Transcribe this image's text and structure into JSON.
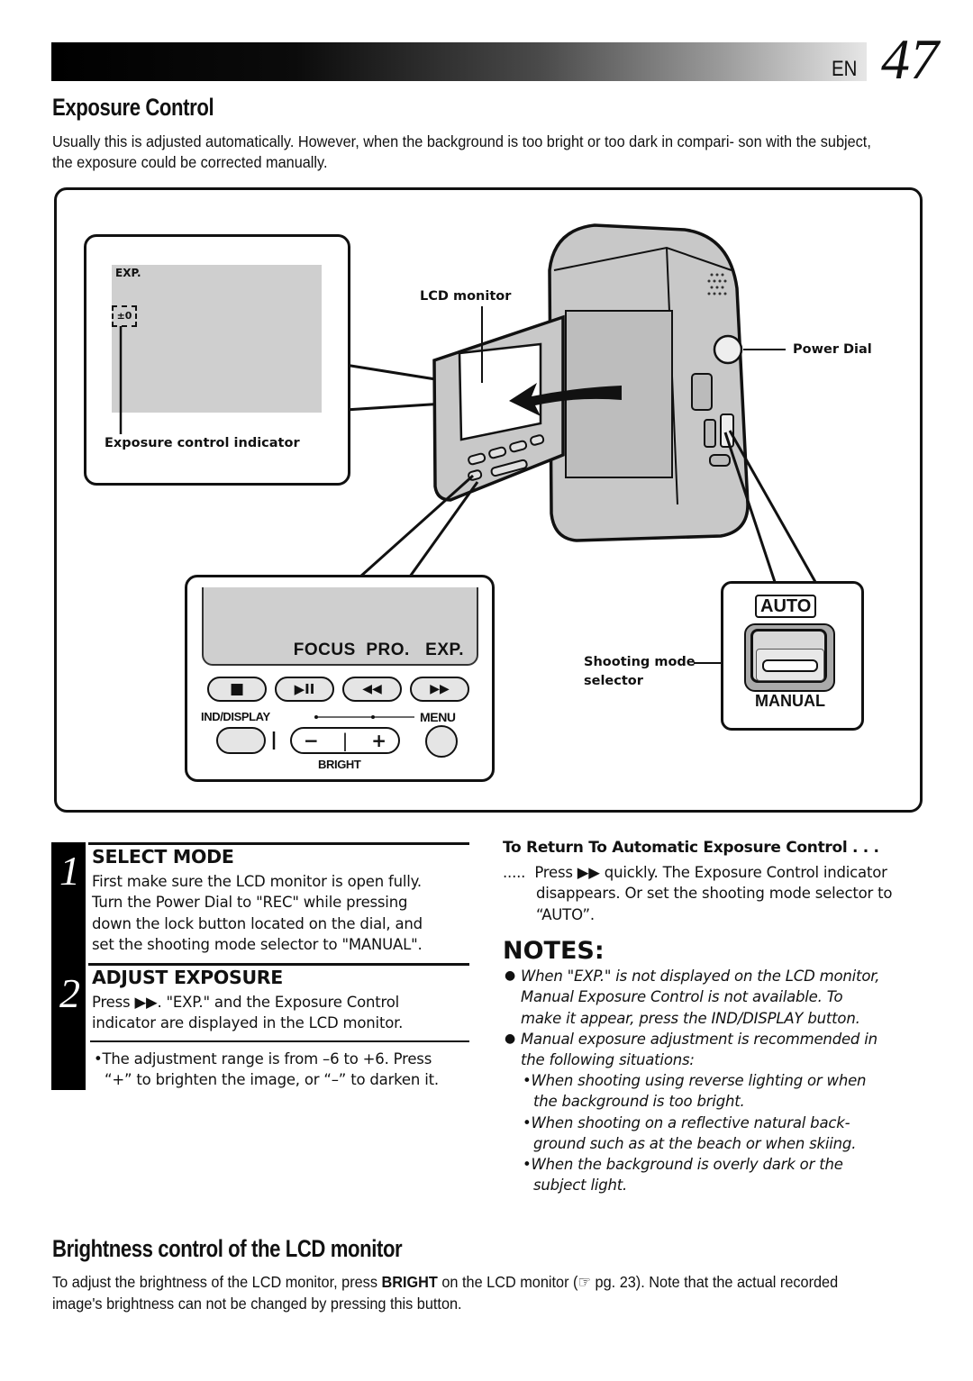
{
  "header": {
    "lang": "EN",
    "page_number": "47"
  },
  "section1": {
    "title": "Exposure Control",
    "intro": "Usually this is adjusted automatically. However, when the background is too bright or too dark in compari- son with the subject, the exposure could be corrected manually."
  },
  "figure": {
    "lcd_inset": {
      "exp_label": "EXP.",
      "indicator_value": "±0",
      "caption": "Exposure control indicator"
    },
    "labels": {
      "lcd_monitor": "LCD monitor",
      "power_dial": "Power Dial",
      "shooting_mode_selector_line1": "Shooting mode",
      "shooting_mode_selector_line2": "selector"
    },
    "control_panel": {
      "display_text": "FOCUS  PRO.   EXP.",
      "buttons": [
        {
          "name": "stop",
          "glyph": "■"
        },
        {
          "name": "play-pause",
          "glyph": "▶II"
        },
        {
          "name": "rewind",
          "glyph": "◀◀"
        },
        {
          "name": "fast-forward",
          "glyph": "▶▶"
        }
      ],
      "ind_display_label": "IND/DISPLAY",
      "menu_label": "MENU",
      "bright_label": "BRIGHT",
      "bright_minus": "−",
      "bright_plus": "+"
    },
    "mode_switch": {
      "auto_label": "AUTO",
      "manual_label": "MANUAL"
    }
  },
  "steps": [
    {
      "number": "1",
      "title": "SELECT MODE",
      "lines": [
        "First make sure the LCD monitor is open fully.",
        "Turn the Power Dial to \"REC\" while pressing",
        "down the lock button located on the dial, and",
        "set the shooting mode selector to \"MANUAL\"."
      ]
    },
    {
      "number": "2",
      "title": "ADJUST EXPOSURE",
      "lines": [
        "Press ▶▶. \"EXP.\" and the Exposure Control",
        "indicator are displayed in the LCD monitor."
      ]
    }
  ],
  "step_note": {
    "bullet": "•",
    "lines": [
      "The adjustment range is from –6 to +6. Press",
      "“+” to brighten the image, or “–” to darken it."
    ]
  },
  "return_auto": {
    "title": "To Return To Automatic Exposure Control . . .",
    "lines": [
      ".....  Press ▶▶ quickly. The Exposure Control indicator",
      "disappears. Or set the shooting mode selector to",
      "“AUTO”."
    ]
  },
  "notes": {
    "title": "NOTES:",
    "items": [
      {
        "lines": [
          "When \"EXP.\" is not displayed on the LCD monitor,",
          "Manual Exposure Control is not available. To",
          "make it appear, press the IND/DISPLAY button."
        ]
      },
      {
        "lines": [
          "Manual exposure adjustment is recommended in",
          "the following situations:"
        ]
      }
    ],
    "sub_items": [
      {
        "lines": [
          "When shooting using reverse lighting or when",
          "the background is too bright."
        ]
      },
      {
        "lines": [
          "When shooting on a reflective natural back-",
          "ground such as at the beach or when skiing."
        ]
      },
      {
        "lines": [
          "When the background is overly dark or the",
          "subject light."
        ]
      }
    ]
  },
  "section2": {
    "title": "Brightness control of the LCD monitor",
    "text_before": "To adjust the brightness of the LCD monitor, press ",
    "bold_word": "BRIGHT",
    "text_after": " on the LCD monitor (☞ pg. 23). Note that the actual recorded image's brightness can not be changed by pressing this button."
  }
}
